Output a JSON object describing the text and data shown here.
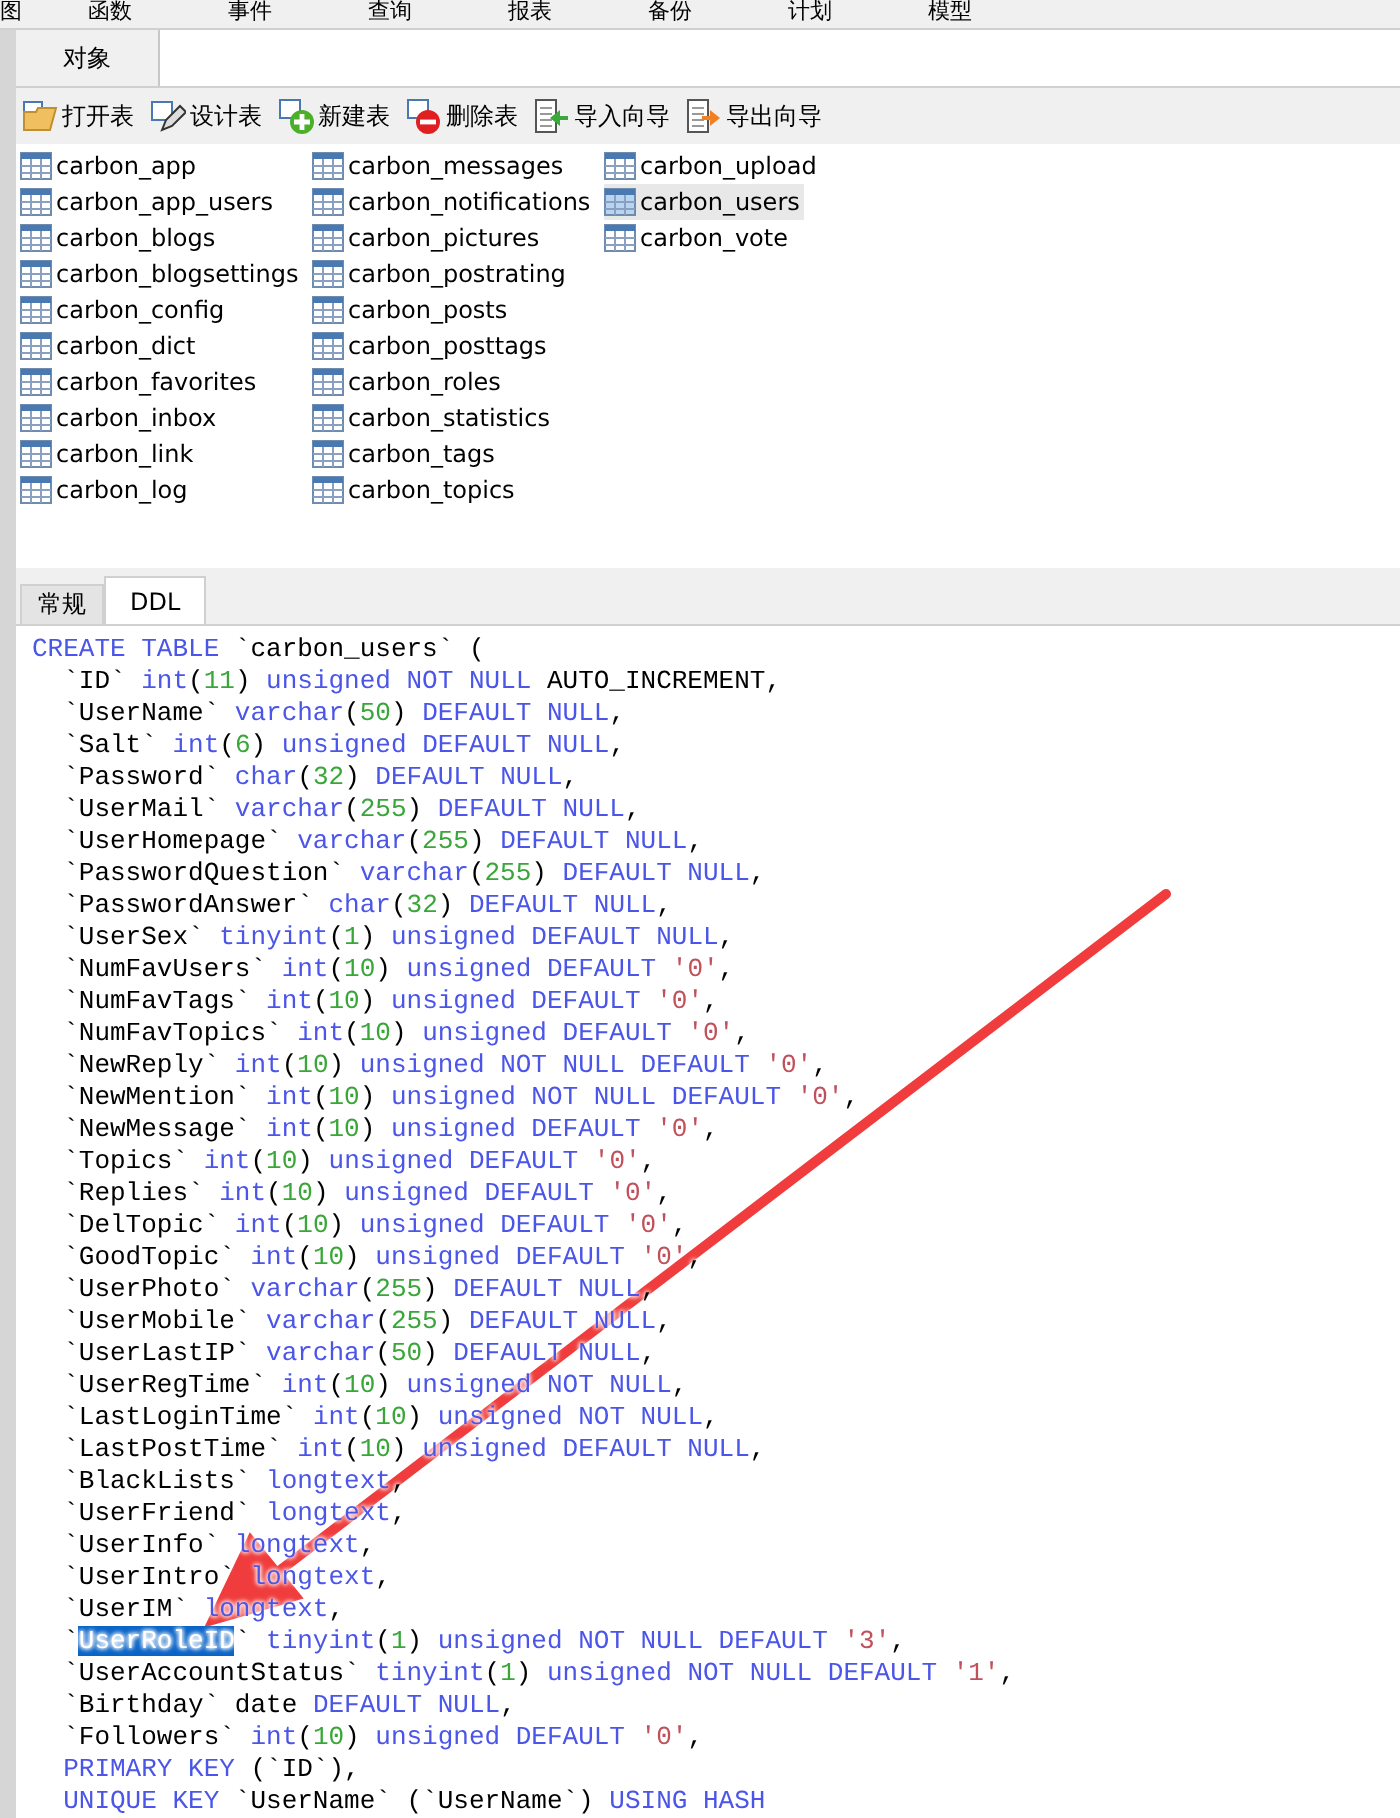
{
  "menu": [
    "图",
    "函数",
    "事件",
    "查询",
    "报表",
    "备份",
    "计划",
    "模型"
  ],
  "object_tabs": [
    {
      "label": "对象",
      "selected": true
    }
  ],
  "toolbar": [
    {
      "kind": "open",
      "label": "打开表"
    },
    {
      "kind": "design",
      "label": "设计表"
    },
    {
      "kind": "new",
      "label": "新建表"
    },
    {
      "kind": "delete",
      "label": "删除表"
    },
    {
      "kind": "import",
      "label": "导入向导"
    },
    {
      "kind": "export",
      "label": "导出向导"
    }
  ],
  "tables": [
    {
      "name": "carbon_app",
      "selected": false
    },
    {
      "name": "carbon_app_users",
      "selected": false
    },
    {
      "name": "carbon_blogs",
      "selected": false
    },
    {
      "name": "carbon_blogsettings",
      "selected": false
    },
    {
      "name": "carbon_config",
      "selected": false
    },
    {
      "name": "carbon_dict",
      "selected": false
    },
    {
      "name": "carbon_favorites",
      "selected": false
    },
    {
      "name": "carbon_inbox",
      "selected": false
    },
    {
      "name": "carbon_link",
      "selected": false
    },
    {
      "name": "carbon_log",
      "selected": false
    },
    {
      "name": "carbon_messages",
      "selected": false
    },
    {
      "name": "carbon_notifications",
      "selected": false
    },
    {
      "name": "carbon_pictures",
      "selected": false
    },
    {
      "name": "carbon_postrating",
      "selected": false
    },
    {
      "name": "carbon_posts",
      "selected": false
    },
    {
      "name": "carbon_posttags",
      "selected": false
    },
    {
      "name": "carbon_roles",
      "selected": false
    },
    {
      "name": "carbon_statistics",
      "selected": false
    },
    {
      "name": "carbon_tags",
      "selected": false
    },
    {
      "name": "carbon_topics",
      "selected": false
    },
    {
      "name": "carbon_upload",
      "selected": false
    },
    {
      "name": "carbon_users",
      "selected": true
    },
    {
      "name": "carbon_vote",
      "selected": false
    }
  ],
  "info_tabs": [
    {
      "label": "常规",
      "selected": false
    },
    {
      "label": "DDL",
      "selected": true
    }
  ],
  "ddl_lines": [
    [
      {
        "kind": "kw",
        "text": "CREATE TABLE"
      },
      {
        "kind": "plain",
        "text": " `carbon_users` ("
      }
    ],
    [
      {
        "kind": "plain",
        "text": "  `ID` "
      },
      {
        "kind": "kw",
        "text": "int"
      },
      {
        "kind": "plain",
        "text": "("
      },
      {
        "kind": "num",
        "text": "11"
      },
      {
        "kind": "plain",
        "text": ") "
      },
      {
        "kind": "kw",
        "text": "unsigned NOT NULL"
      },
      {
        "kind": "plain",
        "text": " AUTO_INCREMENT,"
      }
    ],
    [
      {
        "kind": "plain",
        "text": "  `UserName` "
      },
      {
        "kind": "kw",
        "text": "varchar"
      },
      {
        "kind": "plain",
        "text": "("
      },
      {
        "kind": "num",
        "text": "50"
      },
      {
        "kind": "plain",
        "text": ") "
      },
      {
        "kind": "kw",
        "text": "DEFAULT NULL"
      },
      {
        "kind": "plain",
        "text": ","
      }
    ],
    [
      {
        "kind": "plain",
        "text": "  `Salt` "
      },
      {
        "kind": "kw",
        "text": "int"
      },
      {
        "kind": "plain",
        "text": "("
      },
      {
        "kind": "num",
        "text": "6"
      },
      {
        "kind": "plain",
        "text": ") "
      },
      {
        "kind": "kw",
        "text": "unsigned DEFAULT NULL"
      },
      {
        "kind": "plain",
        "text": ","
      }
    ],
    [
      {
        "kind": "plain",
        "text": "  `Password` "
      },
      {
        "kind": "kw",
        "text": "char"
      },
      {
        "kind": "plain",
        "text": "("
      },
      {
        "kind": "num",
        "text": "32"
      },
      {
        "kind": "plain",
        "text": ") "
      },
      {
        "kind": "kw",
        "text": "DEFAULT NULL"
      },
      {
        "kind": "plain",
        "text": ","
      }
    ],
    [
      {
        "kind": "plain",
        "text": "  `UserMail` "
      },
      {
        "kind": "kw",
        "text": "varchar"
      },
      {
        "kind": "plain",
        "text": "("
      },
      {
        "kind": "num",
        "text": "255"
      },
      {
        "kind": "plain",
        "text": ") "
      },
      {
        "kind": "kw",
        "text": "DEFAULT NULL"
      },
      {
        "kind": "plain",
        "text": ","
      }
    ],
    [
      {
        "kind": "plain",
        "text": "  `UserHomepage` "
      },
      {
        "kind": "kw",
        "text": "varchar"
      },
      {
        "kind": "plain",
        "text": "("
      },
      {
        "kind": "num",
        "text": "255"
      },
      {
        "kind": "plain",
        "text": ") "
      },
      {
        "kind": "kw",
        "text": "DEFAULT NULL"
      },
      {
        "kind": "plain",
        "text": ","
      }
    ],
    [
      {
        "kind": "plain",
        "text": "  `PasswordQuestion` "
      },
      {
        "kind": "kw",
        "text": "varchar"
      },
      {
        "kind": "plain",
        "text": "("
      },
      {
        "kind": "num",
        "text": "255"
      },
      {
        "kind": "plain",
        "text": ") "
      },
      {
        "kind": "kw",
        "text": "DEFAULT NULL"
      },
      {
        "kind": "plain",
        "text": ","
      }
    ],
    [
      {
        "kind": "plain",
        "text": "  `PasswordAnswer` "
      },
      {
        "kind": "kw",
        "text": "char"
      },
      {
        "kind": "plain",
        "text": "("
      },
      {
        "kind": "num",
        "text": "32"
      },
      {
        "kind": "plain",
        "text": ") "
      },
      {
        "kind": "kw",
        "text": "DEFAULT NULL"
      },
      {
        "kind": "plain",
        "text": ","
      }
    ],
    [
      {
        "kind": "plain",
        "text": "  `UserSex` "
      },
      {
        "kind": "kw",
        "text": "tinyint"
      },
      {
        "kind": "plain",
        "text": "("
      },
      {
        "kind": "num",
        "text": "1"
      },
      {
        "kind": "plain",
        "text": ") "
      },
      {
        "kind": "kw",
        "text": "unsigned DEFAULT NULL"
      },
      {
        "kind": "plain",
        "text": ","
      }
    ],
    [
      {
        "kind": "plain",
        "text": "  `NumFavUsers` "
      },
      {
        "kind": "kw",
        "text": "int"
      },
      {
        "kind": "plain",
        "text": "("
      },
      {
        "kind": "num",
        "text": "10"
      },
      {
        "kind": "plain",
        "text": ") "
      },
      {
        "kind": "kw",
        "text": "unsigned DEFAULT "
      },
      {
        "kind": "str",
        "text": "'0'"
      },
      {
        "kind": "plain",
        "text": ","
      }
    ],
    [
      {
        "kind": "plain",
        "text": "  `NumFavTags` "
      },
      {
        "kind": "kw",
        "text": "int"
      },
      {
        "kind": "plain",
        "text": "("
      },
      {
        "kind": "num",
        "text": "10"
      },
      {
        "kind": "plain",
        "text": ") "
      },
      {
        "kind": "kw",
        "text": "unsigned DEFAULT "
      },
      {
        "kind": "str",
        "text": "'0'"
      },
      {
        "kind": "plain",
        "text": ","
      }
    ],
    [
      {
        "kind": "plain",
        "text": "  `NumFavTopics` "
      },
      {
        "kind": "kw",
        "text": "int"
      },
      {
        "kind": "plain",
        "text": "("
      },
      {
        "kind": "num",
        "text": "10"
      },
      {
        "kind": "plain",
        "text": ") "
      },
      {
        "kind": "kw",
        "text": "unsigned DEFAULT "
      },
      {
        "kind": "str",
        "text": "'0'"
      },
      {
        "kind": "plain",
        "text": ","
      }
    ],
    [
      {
        "kind": "plain",
        "text": "  `NewReply` "
      },
      {
        "kind": "kw",
        "text": "int"
      },
      {
        "kind": "plain",
        "text": "("
      },
      {
        "kind": "num",
        "text": "10"
      },
      {
        "kind": "plain",
        "text": ") "
      },
      {
        "kind": "kw",
        "text": "unsigned NOT NULL DEFAULT "
      },
      {
        "kind": "str",
        "text": "'0'"
      },
      {
        "kind": "plain",
        "text": ","
      }
    ],
    [
      {
        "kind": "plain",
        "text": "  `NewMention` "
      },
      {
        "kind": "kw",
        "text": "int"
      },
      {
        "kind": "plain",
        "text": "("
      },
      {
        "kind": "num",
        "text": "10"
      },
      {
        "kind": "plain",
        "text": ") "
      },
      {
        "kind": "kw",
        "text": "unsigned NOT NULL DEFAULT "
      },
      {
        "kind": "str",
        "text": "'0'"
      },
      {
        "kind": "plain",
        "text": ","
      }
    ],
    [
      {
        "kind": "plain",
        "text": "  `NewMessage` "
      },
      {
        "kind": "kw",
        "text": "int"
      },
      {
        "kind": "plain",
        "text": "("
      },
      {
        "kind": "num",
        "text": "10"
      },
      {
        "kind": "plain",
        "text": ") "
      },
      {
        "kind": "kw",
        "text": "unsigned DEFAULT "
      },
      {
        "kind": "str",
        "text": "'0'"
      },
      {
        "kind": "plain",
        "text": ","
      }
    ],
    [
      {
        "kind": "plain",
        "text": "  `Topics` "
      },
      {
        "kind": "kw",
        "text": "int"
      },
      {
        "kind": "plain",
        "text": "("
      },
      {
        "kind": "num",
        "text": "10"
      },
      {
        "kind": "plain",
        "text": ") "
      },
      {
        "kind": "kw",
        "text": "unsigned DEFAULT "
      },
      {
        "kind": "str",
        "text": "'0'"
      },
      {
        "kind": "plain",
        "text": ","
      }
    ],
    [
      {
        "kind": "plain",
        "text": "  `Replies` "
      },
      {
        "kind": "kw",
        "text": "int"
      },
      {
        "kind": "plain",
        "text": "("
      },
      {
        "kind": "num",
        "text": "10"
      },
      {
        "kind": "plain",
        "text": ") "
      },
      {
        "kind": "kw",
        "text": "unsigned DEFAULT "
      },
      {
        "kind": "str",
        "text": "'0'"
      },
      {
        "kind": "plain",
        "text": ","
      }
    ],
    [
      {
        "kind": "plain",
        "text": "  `DelTopic` "
      },
      {
        "kind": "kw",
        "text": "int"
      },
      {
        "kind": "plain",
        "text": "("
      },
      {
        "kind": "num",
        "text": "10"
      },
      {
        "kind": "plain",
        "text": ") "
      },
      {
        "kind": "kw",
        "text": "unsigned DEFAULT "
      },
      {
        "kind": "str",
        "text": "'0'"
      },
      {
        "kind": "plain",
        "text": ","
      }
    ],
    [
      {
        "kind": "plain",
        "text": "  `GoodTopic` "
      },
      {
        "kind": "kw",
        "text": "int"
      },
      {
        "kind": "plain",
        "text": "("
      },
      {
        "kind": "num",
        "text": "10"
      },
      {
        "kind": "plain",
        "text": ") "
      },
      {
        "kind": "kw",
        "text": "unsigned DEFAULT "
      },
      {
        "kind": "str",
        "text": "'0'"
      },
      {
        "kind": "plain",
        "text": ","
      }
    ],
    [
      {
        "kind": "plain",
        "text": "  `UserPhoto` "
      },
      {
        "kind": "kw",
        "text": "varchar"
      },
      {
        "kind": "plain",
        "text": "("
      },
      {
        "kind": "num",
        "text": "255"
      },
      {
        "kind": "plain",
        "text": ") "
      },
      {
        "kind": "kw",
        "text": "DEFAULT NULL"
      },
      {
        "kind": "plain",
        "text": ","
      }
    ],
    [
      {
        "kind": "plain",
        "text": "  `UserMobile` "
      },
      {
        "kind": "kw",
        "text": "varchar"
      },
      {
        "kind": "plain",
        "text": "("
      },
      {
        "kind": "num",
        "text": "255"
      },
      {
        "kind": "plain",
        "text": ") "
      },
      {
        "kind": "kw",
        "text": "DEFAULT NULL"
      },
      {
        "kind": "plain",
        "text": ","
      }
    ],
    [
      {
        "kind": "plain",
        "text": "  `UserLastIP` "
      },
      {
        "kind": "kw",
        "text": "varchar"
      },
      {
        "kind": "plain",
        "text": "("
      },
      {
        "kind": "num",
        "text": "50"
      },
      {
        "kind": "plain",
        "text": ") "
      },
      {
        "kind": "kw",
        "text": "DEFAULT NULL"
      },
      {
        "kind": "plain",
        "text": ","
      }
    ],
    [
      {
        "kind": "plain",
        "text": "  `UserRegTime` "
      },
      {
        "kind": "kw",
        "text": "int"
      },
      {
        "kind": "plain",
        "text": "("
      },
      {
        "kind": "num",
        "text": "10"
      },
      {
        "kind": "plain",
        "text": ") "
      },
      {
        "kind": "kw",
        "text": "unsigned NOT NULL"
      },
      {
        "kind": "plain",
        "text": ","
      }
    ],
    [
      {
        "kind": "plain",
        "text": "  `LastLoginTime` "
      },
      {
        "kind": "kw",
        "text": "int"
      },
      {
        "kind": "plain",
        "text": "("
      },
      {
        "kind": "num",
        "text": "10"
      },
      {
        "kind": "plain",
        "text": ") "
      },
      {
        "kind": "kw",
        "text": "unsigned NOT NULL"
      },
      {
        "kind": "plain",
        "text": ","
      }
    ],
    [
      {
        "kind": "plain",
        "text": "  `LastPostTime` "
      },
      {
        "kind": "kw",
        "text": "int"
      },
      {
        "kind": "plain",
        "text": "("
      },
      {
        "kind": "num",
        "text": "10"
      },
      {
        "kind": "plain",
        "text": ") "
      },
      {
        "kind": "kw",
        "text": "unsigned DEFAULT NULL"
      },
      {
        "kind": "plain",
        "text": ","
      }
    ],
    [
      {
        "kind": "plain",
        "text": "  `BlackLists` "
      },
      {
        "kind": "kw",
        "text": "longtext"
      },
      {
        "kind": "plain",
        "text": ","
      }
    ],
    [
      {
        "kind": "plain",
        "text": "  `UserFriend` "
      },
      {
        "kind": "kw",
        "text": "longtext"
      },
      {
        "kind": "plain",
        "text": ","
      }
    ],
    [
      {
        "kind": "plain",
        "text": "  `UserInfo` "
      },
      {
        "kind": "kw",
        "text": "longtext"
      },
      {
        "kind": "plain",
        "text": ","
      }
    ],
    [
      {
        "kind": "plain",
        "text": "  `UserIntro` "
      },
      {
        "kind": "kw",
        "text": "longtext"
      },
      {
        "kind": "plain",
        "text": ","
      }
    ],
    [
      {
        "kind": "plain",
        "text": "  `UserIM` "
      },
      {
        "kind": "kw",
        "text": "longtext"
      },
      {
        "kind": "plain",
        "text": ","
      }
    ],
    [
      {
        "kind": "plain",
        "text": "  `"
      },
      {
        "kind": "sel",
        "text": "UserRoleID"
      },
      {
        "kind": "plain",
        "text": "` "
      },
      {
        "kind": "kw",
        "text": "tinyint"
      },
      {
        "kind": "plain",
        "text": "("
      },
      {
        "kind": "num",
        "text": "1"
      },
      {
        "kind": "plain",
        "text": ") "
      },
      {
        "kind": "kw",
        "text": "unsigned NOT NULL DEFAULT "
      },
      {
        "kind": "str",
        "text": "'3'"
      },
      {
        "kind": "plain",
        "text": ","
      }
    ],
    [
      {
        "kind": "plain",
        "text": "  `UserAccountStatus` "
      },
      {
        "kind": "kw",
        "text": "tinyint"
      },
      {
        "kind": "plain",
        "text": "("
      },
      {
        "kind": "num",
        "text": "1"
      },
      {
        "kind": "plain",
        "text": ") "
      },
      {
        "kind": "kw",
        "text": "unsigned NOT NULL DEFAULT "
      },
      {
        "kind": "str",
        "text": "'1'"
      },
      {
        "kind": "plain",
        "text": ","
      }
    ],
    [
      {
        "kind": "plain",
        "text": "  `Birthday` date "
      },
      {
        "kind": "kw",
        "text": "DEFAULT NULL"
      },
      {
        "kind": "plain",
        "text": ","
      }
    ],
    [
      {
        "kind": "plain",
        "text": "  `Followers` "
      },
      {
        "kind": "kw",
        "text": "int"
      },
      {
        "kind": "plain",
        "text": "("
      },
      {
        "kind": "num",
        "text": "10"
      },
      {
        "kind": "plain",
        "text": ") "
      },
      {
        "kind": "kw",
        "text": "unsigned DEFAULT "
      },
      {
        "kind": "str",
        "text": "'0'"
      },
      {
        "kind": "plain",
        "text": ","
      }
    ],
    [
      {
        "kind": "kw",
        "text": "  PRIMARY KEY"
      },
      {
        "kind": "plain",
        "text": " (`ID`),"
      }
    ],
    [
      {
        "kind": "kw",
        "text": "  UNIQUE KEY"
      },
      {
        "kind": "plain",
        "text": " `UserName` (`UserName`) "
      },
      {
        "kind": "kw",
        "text": "USING HASH"
      }
    ]
  ]
}
